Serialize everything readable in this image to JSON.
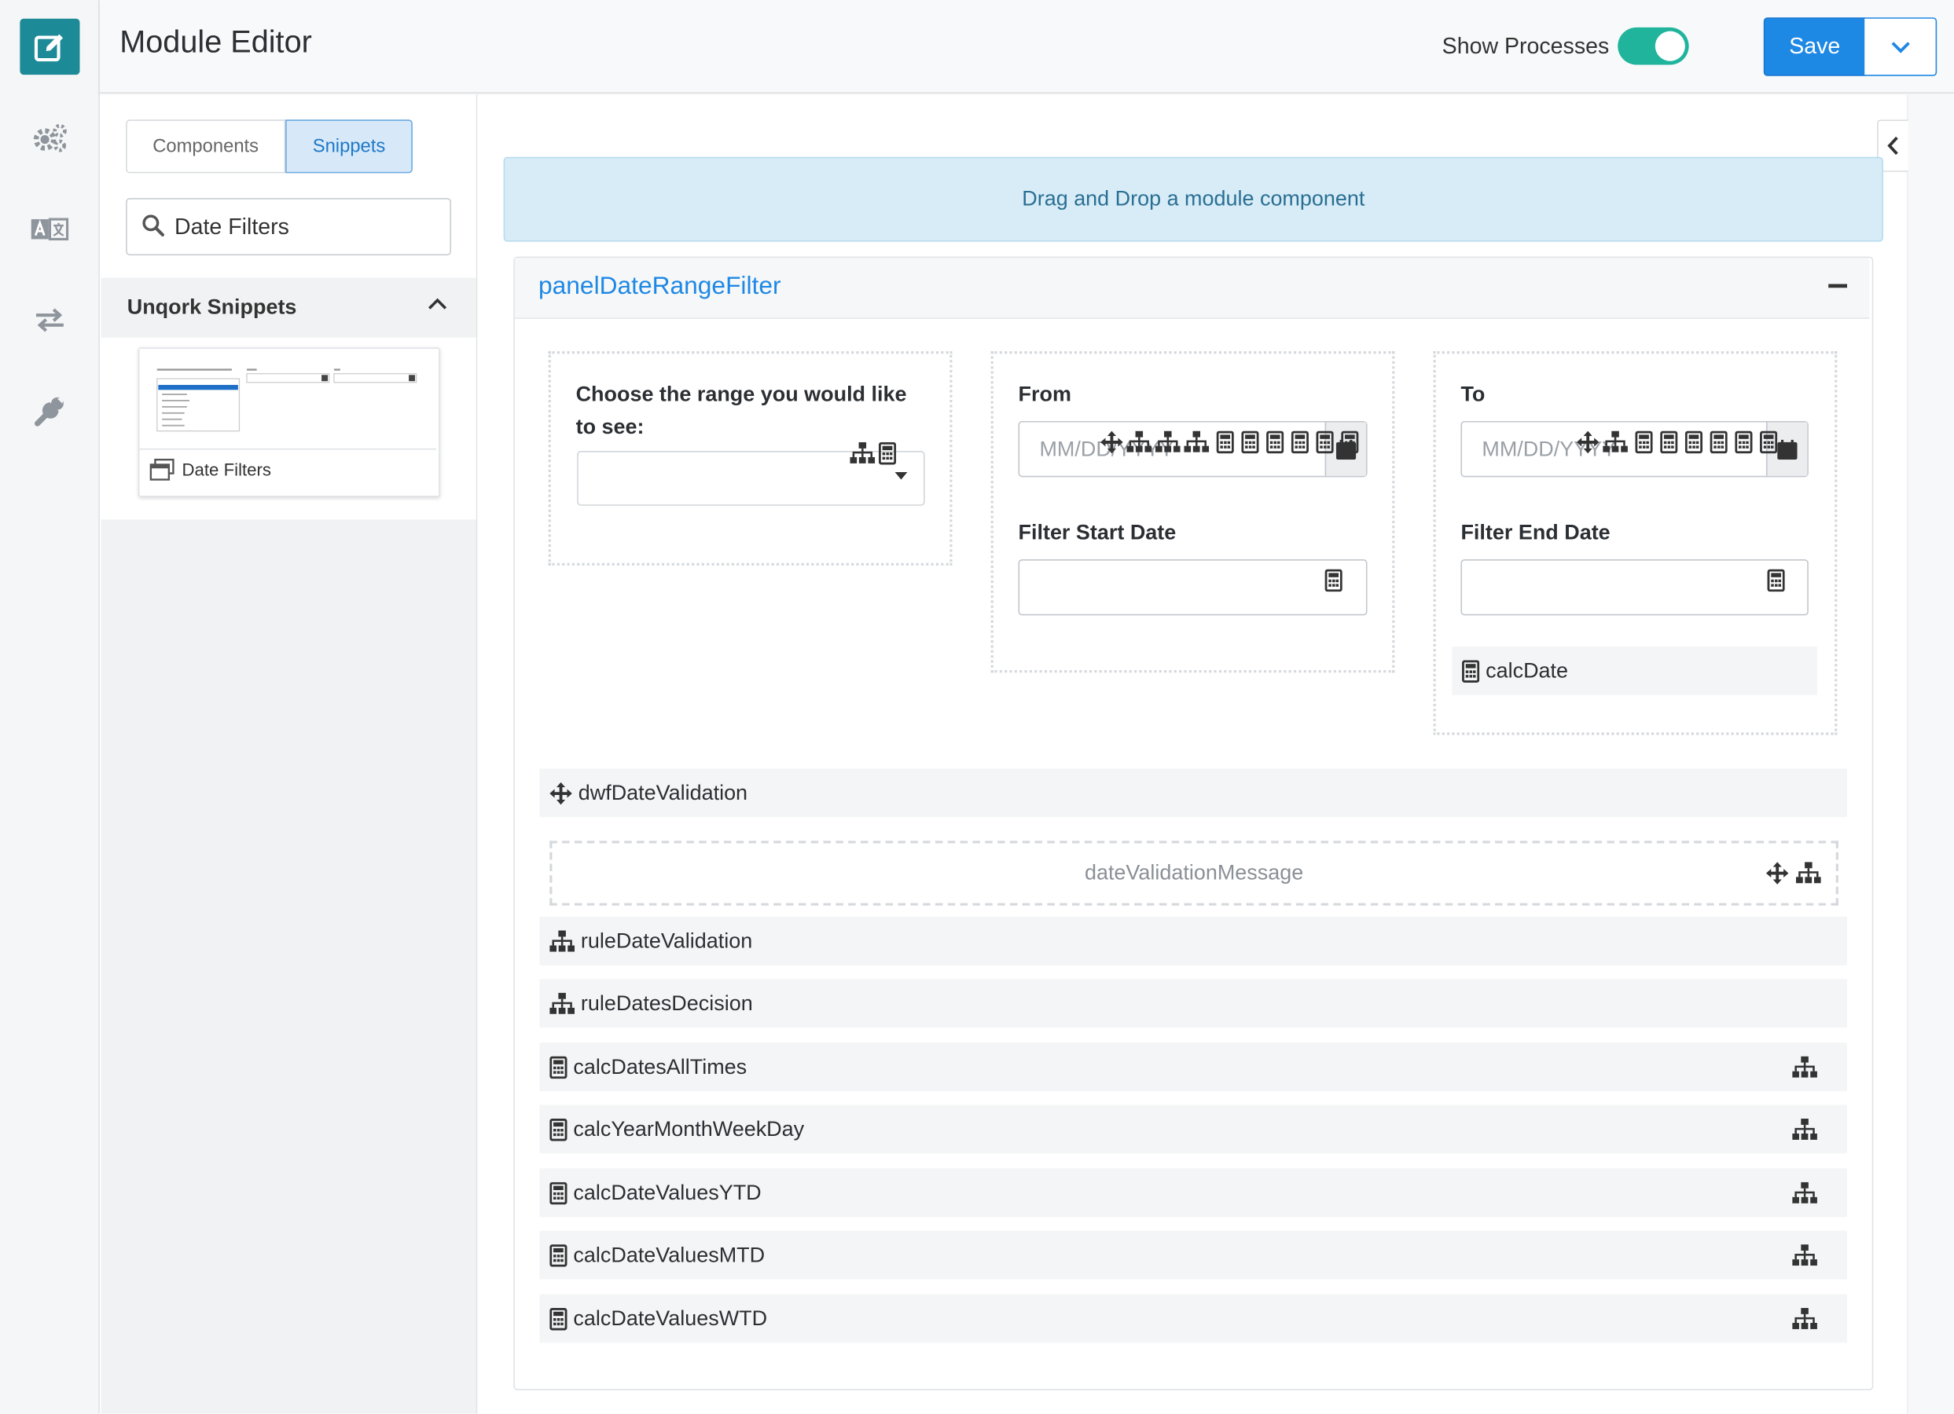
{
  "header": {
    "title": "Module Editor",
    "show_processes_label": "Show Processes",
    "show_processes_on": true,
    "save_label": "Save"
  },
  "rail": {
    "items": [
      {
        "name": "module-editor",
        "icon": "edit-icon",
        "active": true
      },
      {
        "name": "settings",
        "icon": "gears-icon"
      },
      {
        "name": "translations",
        "icon": "translate-icon"
      },
      {
        "name": "data-workflow",
        "icon": "exchange-icon"
      },
      {
        "name": "tools",
        "icon": "wrench-icon"
      }
    ]
  },
  "sidebar": {
    "tabs": [
      {
        "label": "Components"
      },
      {
        "label": "Snippets",
        "active": true
      }
    ],
    "search": {
      "value": "Date Filters"
    },
    "section_title": "Unqork Snippets",
    "snippets": [
      {
        "label": "Date Filters"
      }
    ]
  },
  "canvas": {
    "dropzone_text": "Drag and Drop a module component",
    "panel": {
      "title": "panelDateRangeFilter",
      "col1": {
        "label": "Choose the range you would like to see:"
      },
      "col2": {
        "from_label": "From",
        "from_placeholder": "MM/DD/YYYY",
        "start_label": "Filter Start Date"
      },
      "col3": {
        "to_label": "To",
        "to_placeholder": "MM/DD/YYYY",
        "end_label": "Filter End Date",
        "calc_label": "calcDate"
      },
      "rows": [
        {
          "label": "dwfDateValidation",
          "icon": "move-icon"
        },
        {
          "label": "dateValidationMessage",
          "kind": "html"
        },
        {
          "label": "ruleDateValidation",
          "icon": "sitemap-icon"
        },
        {
          "label": "ruleDatesDecision",
          "icon": "sitemap-icon"
        },
        {
          "label": "calcDatesAllTimes",
          "icon": "calculator-icon"
        },
        {
          "label": "calcYearMonthWeekDay",
          "icon": "calculator-icon"
        },
        {
          "label": "calcDateValuesYTD",
          "icon": "calculator-icon"
        },
        {
          "label": "calcDateValuesMTD",
          "icon": "calculator-icon"
        },
        {
          "label": "calcDateValuesWTD",
          "icon": "calculator-icon"
        }
      ]
    }
  },
  "colors": {
    "accent": "#1e88e5",
    "toggle_on": "#20b49d",
    "rail_active": "#1d8a98",
    "dropzone_bg": "#d7ecf7"
  }
}
